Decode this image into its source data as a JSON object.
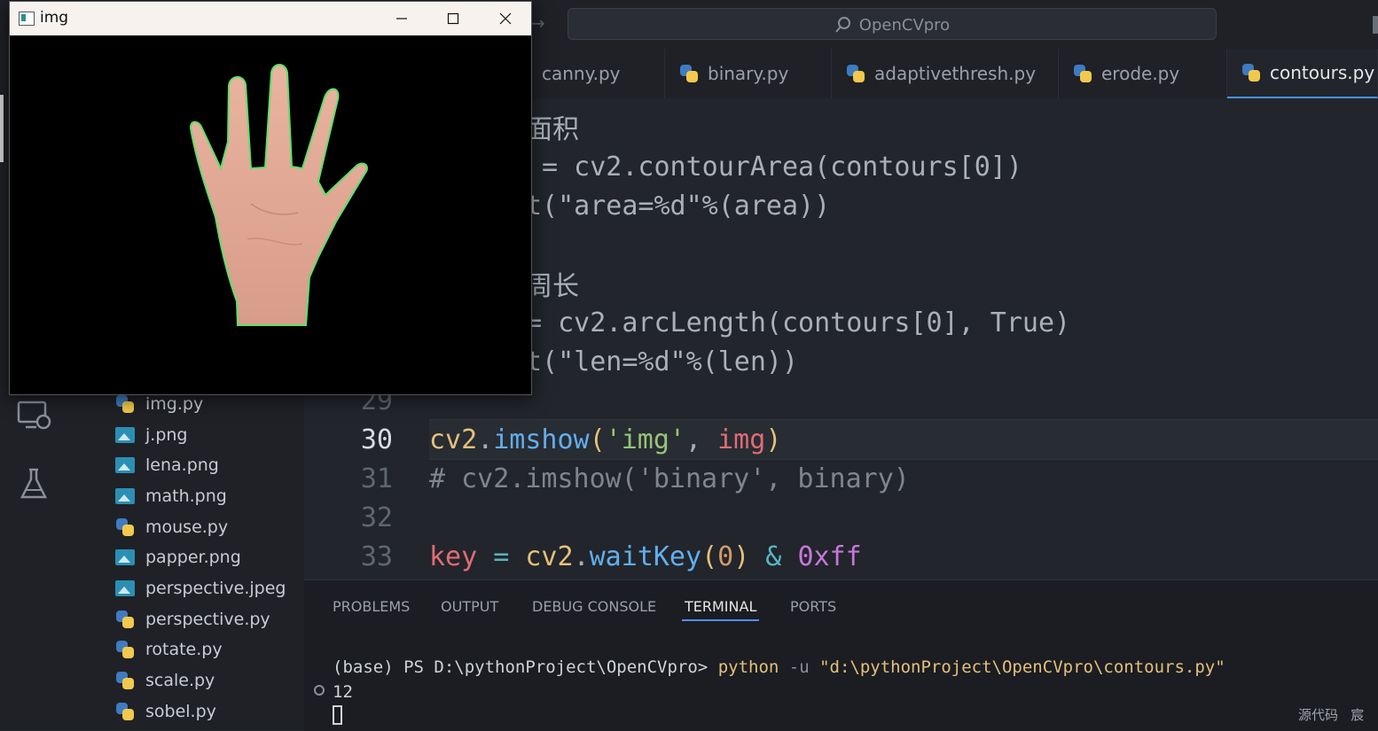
{
  "window": {
    "title": "img"
  },
  "search": {
    "label": "OpenCVpro"
  },
  "tabs": [
    {
      "label": "canny.py"
    },
    {
      "label": "binary.py"
    },
    {
      "label": "adaptivethresh.py"
    },
    {
      "label": "erode.py"
    },
    {
      "label": "contours.py",
      "active": true
    }
  ],
  "explorer": {
    "files": [
      {
        "name": "img.py",
        "type": "python"
      },
      {
        "name": "j.png",
        "type": "image"
      },
      {
        "name": "lena.png",
        "type": "image"
      },
      {
        "name": "math.png",
        "type": "image"
      },
      {
        "name": "mouse.py",
        "type": "python"
      },
      {
        "name": "papper.png",
        "type": "image"
      },
      {
        "name": "perspective.jpeg",
        "type": "image"
      },
      {
        "name": "perspective.py",
        "type": "python"
      },
      {
        "name": "rotate.py",
        "type": "python"
      },
      {
        "name": "scale.py",
        "type": "python"
      },
      {
        "name": "sobel.py",
        "type": "python"
      }
    ]
  },
  "editor": {
    "partial": {
      "l1": "面积",
      "l2": " = cv2.contourArea(contours[0])",
      "l3": "t(\"area=%d\"%(area))",
      "l4": "周长",
      "l5": "= cv2.arcLength(contours[0], True)",
      "l6": "t(\"len=%d\"%(len))"
    },
    "line29": {
      "num": "29"
    },
    "line30": {
      "num": "30",
      "a": "cv2",
      "b": ".",
      "c": "imshow",
      "d": "(",
      "e": "'img'",
      "f": ", ",
      "g": "img",
      "h": ")"
    },
    "line31": {
      "num": "31",
      "text": "# cv2.imshow('binary', binary)"
    },
    "line32": {
      "num": "32"
    },
    "line33": {
      "num": "33",
      "a": "key",
      "b": " = ",
      "c": "cv2",
      "d": ".",
      "e": "waitKey",
      "f": "(",
      "g": "0",
      "h": ")",
      "i": " & ",
      "j": "0xff"
    }
  },
  "panel": {
    "tabs": [
      "PROBLEMS",
      "OUTPUT",
      "DEBUG CONSOLE",
      "TERMINAL",
      "PORTS"
    ],
    "active_tab": "TERMINAL",
    "prompt": "(base) PS D:\\pythonProject\\OpenCVpro> ",
    "cmd": "python",
    "flag": " -u ",
    "path": "\"d:\\pythonProject\\OpenCVpro\\contours.py\"",
    "output": "12"
  },
  "status": {
    "right": "源代码   宸"
  },
  "icons": {
    "search": "search-icon",
    "python": "python-file-icon",
    "image": "image-file-icon",
    "remote": "remote-explorer-icon",
    "testing": "flask-icon"
  }
}
